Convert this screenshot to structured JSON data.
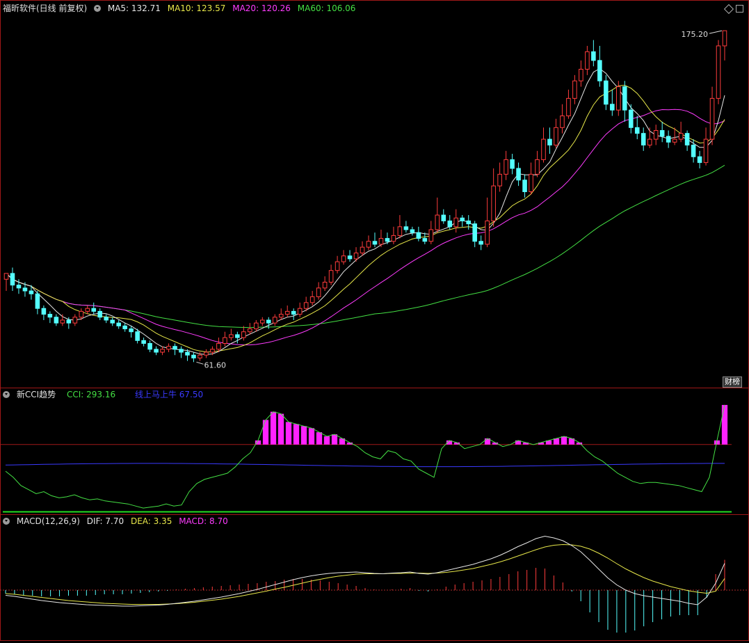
{
  "main_panel": {
    "title": "福昕软件(日线 前复权)",
    "indicators": [
      {
        "label": "MA5: 132.71",
        "color": "#e8e8e8"
      },
      {
        "label": "MA10: 123.57",
        "color": "#e8e84a"
      },
      {
        "label": "MA20: 120.26",
        "color": "#ff3cff"
      },
      {
        "label": "MA60: 106.06",
        "color": "#44e044"
      }
    ],
    "high_label": "175.20",
    "low_label": "61.60",
    "caibang_label": "财榜"
  },
  "cci_panel": {
    "title": "新CCI趋势",
    "indicators": [
      {
        "label": "CCI: 293.16",
        "color": "#44e044"
      },
      {
        "label": "线上马上牛  67.50",
        "color": "#3a3aff"
      }
    ]
  },
  "macd_panel": {
    "title": "MACD(12,26,9)",
    "indicators": [
      {
        "label": "DIF: 7.70",
        "color": "#e8e8e8"
      },
      {
        "label": "DEA: 3.35",
        "color": "#e8e84a"
      },
      {
        "label": "MACD: 8.70",
        "color": "#ff3cff"
      }
    ]
  },
  "colors": {
    "up": "#ff3c3c",
    "down": "#54ffff",
    "ma5": "#e8e8e8",
    "ma10": "#e8e84a",
    "ma20": "#ff3cff",
    "ma60": "#44e044",
    "cci": "#44e044",
    "cci_base": "#3a3aff",
    "cci_bar": "#ff22ff",
    "panel_border": "#a01818",
    "macd_up": "#ff3c3c",
    "macd_down": "#54ffff"
  },
  "chart_data": [
    {
      "type": "candlestick",
      "title": "福昕软件(日线 前复权)",
      "ylim": [
        55,
        180
      ],
      "candles": [
        [
          90,
          92,
          92,
          86
        ],
        [
          92,
          88,
          94,
          86
        ],
        [
          88,
          87,
          90,
          85
        ],
        [
          87,
          86,
          89,
          84
        ],
        [
          86,
          85,
          88,
          83
        ],
        [
          85,
          80,
          86,
          78
        ],
        [
          80,
          78,
          81,
          76
        ],
        [
          78,
          77,
          79,
          75
        ],
        [
          77,
          75,
          78,
          74
        ],
        [
          75,
          76,
          78,
          74
        ],
        [
          76,
          75,
          77,
          73
        ],
        [
          75,
          77,
          78,
          74
        ],
        [
          77,
          79,
          80,
          76
        ],
        [
          79,
          80,
          81,
          78
        ],
        [
          80,
          79,
          82,
          78
        ],
        [
          79,
          77,
          80,
          76
        ],
        [
          77,
          76,
          78,
          75
        ],
        [
          76,
          75,
          77,
          74
        ],
        [
          75,
          74,
          76,
          73
        ],
        [
          74,
          73,
          75,
          72
        ],
        [
          73,
          72,
          74,
          70
        ],
        [
          72,
          69,
          73,
          68
        ],
        [
          69,
          68,
          70,
          67
        ],
        [
          68,
          66,
          69,
          65
        ],
        [
          66,
          65,
          67,
          64
        ],
        [
          65,
          66,
          67,
          64
        ],
        [
          66,
          67,
          68,
          65
        ],
        [
          67,
          66,
          68,
          64
        ],
        [
          66,
          65,
          67,
          63
        ],
        [
          65,
          64,
          66,
          62
        ],
        [
          64,
          63,
          65,
          61.6
        ],
        [
          63,
          64,
          65,
          62
        ],
        [
          64,
          65,
          66,
          63
        ],
        [
          65,
          66,
          67,
          64
        ],
        [
          66,
          68,
          70,
          65
        ],
        [
          68,
          70,
          72,
          67
        ],
        [
          70,
          71,
          73,
          69
        ],
        [
          71,
          70,
          72,
          68
        ],
        [
          70,
          72,
          74,
          69
        ],
        [
          72,
          73,
          75,
          71
        ],
        [
          73,
          75,
          76,
          72
        ],
        [
          75,
          76,
          77,
          74
        ],
        [
          76,
          75,
          77,
          73
        ],
        [
          75,
          77,
          78,
          74
        ],
        [
          77,
          78,
          80,
          76
        ],
        [
          78,
          79,
          81,
          77
        ],
        [
          79,
          78,
          80,
          76
        ],
        [
          78,
          80,
          82,
          77
        ],
        [
          80,
          82,
          84,
          79
        ],
        [
          82,
          84,
          86,
          81
        ],
        [
          84,
          87,
          89,
          83
        ],
        [
          87,
          89,
          91,
          86
        ],
        [
          89,
          93,
          95,
          88
        ],
        [
          93,
          96,
          98,
          92
        ],
        [
          96,
          98,
          100,
          95
        ],
        [
          98,
          97,
          100,
          96
        ],
        [
          97,
          99,
          101,
          96
        ],
        [
          99,
          101,
          103,
          98
        ],
        [
          101,
          103,
          105,
          100
        ],
        [
          103,
          102,
          106,
          101
        ],
        [
          102,
          104,
          107,
          101
        ],
        [
          104,
          103,
          106,
          102
        ],
        [
          103,
          105,
          108,
          102
        ],
        [
          105,
          108,
          112,
          104
        ],
        [
          108,
          107,
          110,
          106
        ],
        [
          107,
          106,
          108,
          105
        ],
        [
          106,
          104,
          108,
          103
        ],
        [
          104,
          103,
          106,
          102
        ],
        [
          103,
          107,
          110,
          102
        ],
        [
          107,
          112,
          118,
          106
        ],
        [
          112,
          110,
          114,
          109
        ],
        [
          110,
          108,
          112,
          107
        ],
        [
          108,
          111,
          114,
          106
        ],
        [
          111,
          110,
          112,
          108
        ],
        [
          110,
          109,
          112,
          107
        ],
        [
          109,
          103,
          110,
          101
        ],
        [
          103,
          102,
          105,
          100
        ],
        [
          102,
          110,
          118,
          101
        ],
        [
          110,
          122,
          128,
          108
        ],
        [
          122,
          126,
          130,
          120
        ],
        [
          126,
          131,
          134,
          124
        ],
        [
          131,
          128,
          133,
          126
        ],
        [
          128,
          124,
          130,
          122
        ],
        [
          124,
          120,
          126,
          118
        ],
        [
          120,
          126,
          130,
          119
        ],
        [
          126,
          131,
          134,
          125
        ],
        [
          131,
          138,
          142,
          130
        ],
        [
          138,
          136,
          142,
          133
        ],
        [
          136,
          142,
          145,
          135
        ],
        [
          142,
          146,
          150,
          140
        ],
        [
          146,
          152,
          155,
          145
        ],
        [
          152,
          158,
          160,
          150
        ],
        [
          158,
          162,
          165,
          156
        ],
        [
          162,
          168,
          170,
          160
        ],
        [
          168,
          165,
          172,
          163
        ],
        [
          165,
          158,
          170,
          156
        ],
        [
          158,
          150,
          160,
          148
        ],
        [
          150,
          148,
          155,
          146
        ],
        [
          148,
          156,
          158,
          146
        ],
        [
          156,
          148,
          158,
          144
        ],
        [
          148,
          142,
          150,
          140
        ],
        [
          142,
          140,
          146,
          138
        ],
        [
          140,
          136,
          142,
          134
        ],
        [
          136,
          138,
          142,
          135
        ],
        [
          138,
          141,
          143,
          136
        ],
        [
          141,
          139,
          144,
          137
        ],
        [
          139,
          137,
          141,
          135
        ],
        [
          137,
          138,
          142,
          136
        ],
        [
          138,
          140,
          144,
          137
        ],
        [
          140,
          136,
          141,
          134
        ],
        [
          136,
          132,
          138,
          130
        ],
        [
          132,
          130,
          134,
          128
        ],
        [
          130,
          138,
          142,
          129
        ],
        [
          138,
          152,
          156,
          136
        ],
        [
          152,
          170,
          172,
          150
        ],
        [
          170,
          175.2,
          175.2,
          165
        ]
      ],
      "ma5_last": 132.71,
      "ma10_last": 123.57,
      "ma20_last": 120.26,
      "ma60_last": 106.06,
      "high": 175.2,
      "low": 61.6
    },
    {
      "type": "bar",
      "title": "新CCI趋势",
      "series": [
        {
          "name": "CCI",
          "values": [
            -30,
            -60,
            -100,
            -120,
            -140,
            -130,
            -150,
            -160,
            -155,
            -145,
            -160,
            -170,
            -165,
            -175,
            -180,
            -185,
            -190,
            -200,
            -210,
            -205,
            -200,
            -190,
            -200,
            -195,
            -130,
            -90,
            -70,
            -60,
            -50,
            -40,
            -10,
            30,
            60,
            120,
            220,
            260,
            250,
            210,
            200,
            190,
            180,
            160,
            140,
            150,
            130,
            110,
            90,
            60,
            40,
            30,
            70,
            60,
            30,
            20,
            -20,
            -40,
            -60,
            80,
            120,
            110,
            80,
            90,
            100,
            130,
            110,
            90,
            100,
            120,
            110,
            100,
            110,
            120,
            130,
            140,
            130,
            110,
            70,
            40,
            20,
            -10,
            -40,
            -60,
            -80,
            -90,
            -85,
            -85,
            -90,
            -95,
            -100,
            -110,
            -120,
            -130,
            -60,
            120,
            293.16
          ]
        },
        {
          "name": "线上马上牛",
          "values": [
            0,
            0,
            0,
            0,
            0,
            0,
            0,
            0,
            0,
            0,
            0,
            0,
            0,
            0,
            0,
            0,
            0,
            0,
            0,
            0,
            0,
            0,
            0,
            0,
            0,
            0,
            0,
            0,
            0,
            0,
            0,
            0,
            0,
            0,
            0,
            0,
            0,
            0,
            0,
            0,
            0,
            0,
            0,
            0,
            0,
            0,
            0,
            0,
            0,
            0,
            0,
            0,
            0,
            0,
            0,
            0,
            0,
            0,
            0,
            0,
            0,
            0,
            0,
            0,
            0,
            0,
            0,
            0,
            0,
            0,
            0,
            0,
            0,
            0,
            0,
            0,
            0,
            0,
            0,
            0,
            0,
            0,
            0,
            0,
            0,
            0,
            0,
            0,
            0,
            0,
            0,
            0,
            0,
            0,
            67.5
          ]
        }
      ],
      "ylim": [
        -230,
        320
      ],
      "threshold": 100
    },
    {
      "type": "line",
      "title": "MACD(12,26,9)",
      "series": [
        {
          "name": "DIF",
          "values": [
            -1.5,
            -1.8,
            -2.2,
            -2.6,
            -3.0,
            -3.3,
            -3.6,
            -3.8,
            -4.0,
            -4.2,
            -4.3,
            -4.4,
            -4.5,
            -4.6,
            -4.6,
            -4.5,
            -4.4,
            -4.3,
            -4.1,
            -3.8,
            -3.5,
            -3.2,
            -2.8,
            -2.4,
            -2.0,
            -1.5,
            -1.0,
            -0.4,
            0.2,
            0.9,
            1.6,
            2.3,
            3.0,
            3.6,
            4.1,
            4.5,
            4.8,
            5.0,
            5.1,
            5.2,
            5.0,
            4.8,
            4.7,
            4.9,
            5.0,
            5.2,
            4.8,
            4.6,
            5.0,
            5.6,
            6.2,
            6.8,
            7.4,
            8.2,
            9.0,
            10.0,
            11.2,
            12.5,
            13.6,
            14.8,
            15.5,
            15.0,
            14.2,
            12.8,
            11.0,
            8.6,
            6.0,
            3.5,
            1.5,
            0.0,
            -1.0,
            -1.6,
            -2.0,
            -2.4,
            -2.8,
            -3.2,
            -3.8,
            -4.2,
            -2.0,
            2.0,
            7.7
          ]
        },
        {
          "name": "DEA",
          "values": [
            -1.0,
            -1.2,
            -1.5,
            -1.8,
            -2.1,
            -2.4,
            -2.7,
            -3.0,
            -3.2,
            -3.4,
            -3.6,
            -3.8,
            -3.9,
            -4.0,
            -4.1,
            -4.1,
            -4.1,
            -4.1,
            -4.0,
            -3.9,
            -3.7,
            -3.5,
            -3.2,
            -2.9,
            -2.6,
            -2.2,
            -1.8,
            -1.3,
            -0.8,
            -0.3,
            0.3,
            0.8,
            1.4,
            2.0,
            2.6,
            3.1,
            3.6,
            4.0,
            4.3,
            4.6,
            4.7,
            4.7,
            4.7,
            4.8,
            4.8,
            4.9,
            4.9,
            4.8,
            4.9,
            5.1,
            5.4,
            5.8,
            6.2,
            6.8,
            7.4,
            8.1,
            8.9,
            9.8,
            10.7,
            11.6,
            12.4,
            12.9,
            13.1,
            13.0,
            12.6,
            11.8,
            10.6,
            9.2,
            7.6,
            6.1,
            4.8,
            3.6,
            2.6,
            1.8,
            1.0,
            0.4,
            -0.2,
            -0.6,
            -0.9,
            -0.3,
            3.35
          ]
        },
        {
          "name": "MACD",
          "values": [
            -1.0,
            -1.2,
            -1.4,
            -1.6,
            -1.8,
            -1.8,
            -1.8,
            -1.6,
            -1.6,
            -1.6,
            -1.4,
            -1.2,
            -1.2,
            -1.2,
            -1.0,
            -0.8,
            -0.6,
            -0.4,
            -0.2,
            0.2,
            0.4,
            0.6,
            0.8,
            1.0,
            1.2,
            1.4,
            1.6,
            1.8,
            2.0,
            2.4,
            2.6,
            3.0,
            3.2,
            3.2,
            3.0,
            2.8,
            2.4,
            2.0,
            1.6,
            1.2,
            0.6,
            0.2,
            0.0,
            0.2,
            0.4,
            0.6,
            -0.2,
            -0.4,
            0.2,
            1.0,
            1.6,
            2.0,
            2.4,
            2.8,
            3.2,
            3.8,
            4.6,
            5.4,
            5.8,
            6.4,
            6.2,
            4.2,
            2.2,
            -0.4,
            -3.2,
            -6.4,
            -9.2,
            -11.4,
            -12.2,
            -12.2,
            -11.6,
            -10.4,
            -9.2,
            -8.4,
            -7.6,
            -7.2,
            -7.2,
            -7.2,
            -2.2,
            4.6,
            8.7
          ]
        }
      ],
      "ylim": [
        -14,
        18
      ]
    }
  ]
}
